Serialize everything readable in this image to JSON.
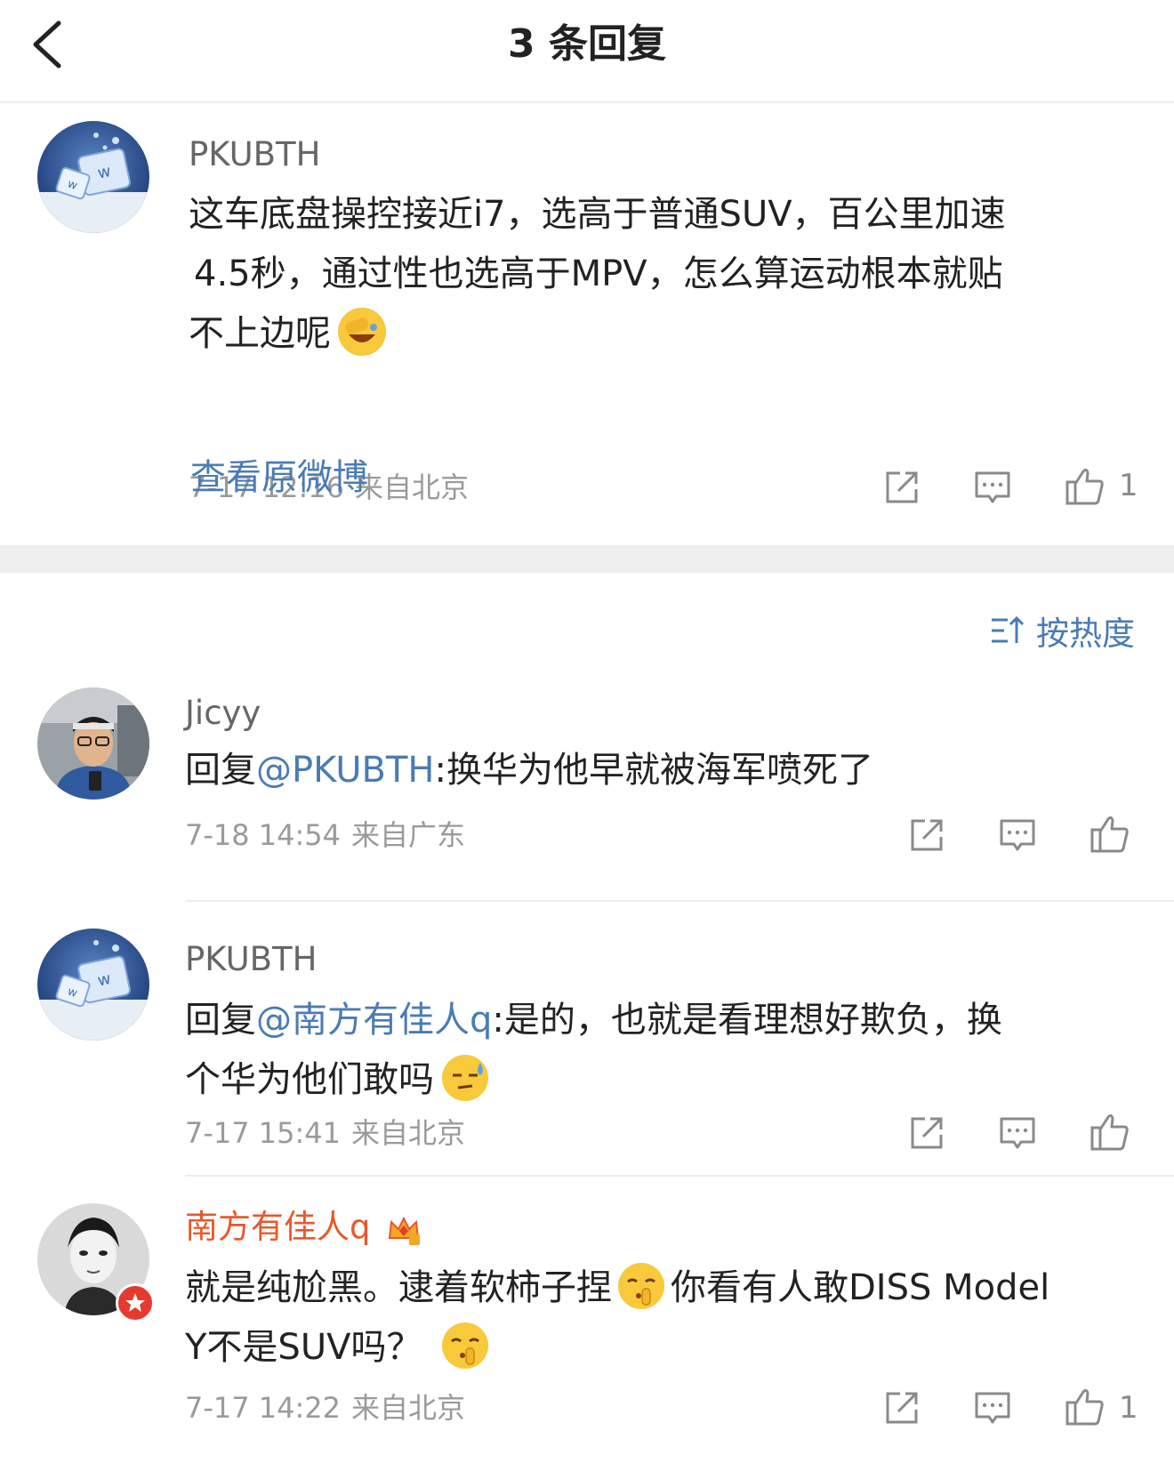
{
  "header": {
    "title": "3 条回复"
  },
  "main_post": {
    "username": "PKUBTH",
    "lines": [
      "这车底盘操控接近i7，选高于普通SUV，百公里加速",
      "4.5秒，通过性也选高于MPV，怎么算运动根本就贴",
      "不上边呢"
    ],
    "time": "7-17 12:16",
    "location": "来自北京",
    "like_count": "1",
    "view_original": "查看原微博"
  },
  "sort": {
    "label": "按热度"
  },
  "replies": [
    {
      "username": "Jicyy",
      "reply_prefix": "回复",
      "mention": "@PKUBTH",
      "text": ":换华为他早就被海军喷死了",
      "time": "7-18 14:54",
      "location": "来自广东",
      "like_count": ""
    },
    {
      "username": "PKUBTH",
      "reply_prefix": "回复",
      "mention": "@南方有佳人q",
      "text_line1": ":是的，也就是看理想好欺负，换",
      "text_line2": "个华为他们敢吗",
      "time": "7-17 15:41",
      "location": "来自北京",
      "like_count": ""
    },
    {
      "username": "南方有佳人q",
      "text_part1": "就是纯尬黑。逮着软柿子捏",
      "text_part2": "你看有人敢DISS Model",
      "text_line2": "Y不是SUV吗？",
      "time": "7-17 14:22",
      "location": "来自北京",
      "like_count": "1"
    }
  ],
  "colors": {
    "link": "#4a7bb5",
    "vip_name": "#e8582c",
    "muted": "#9a9a9a",
    "divider": "#ececec",
    "band": "#efefef"
  },
  "icons": {
    "back": "chevron-left-icon",
    "share": "share-icon",
    "comment": "comment-icon",
    "like": "thumbs-up-icon",
    "sort": "sort-icon"
  }
}
